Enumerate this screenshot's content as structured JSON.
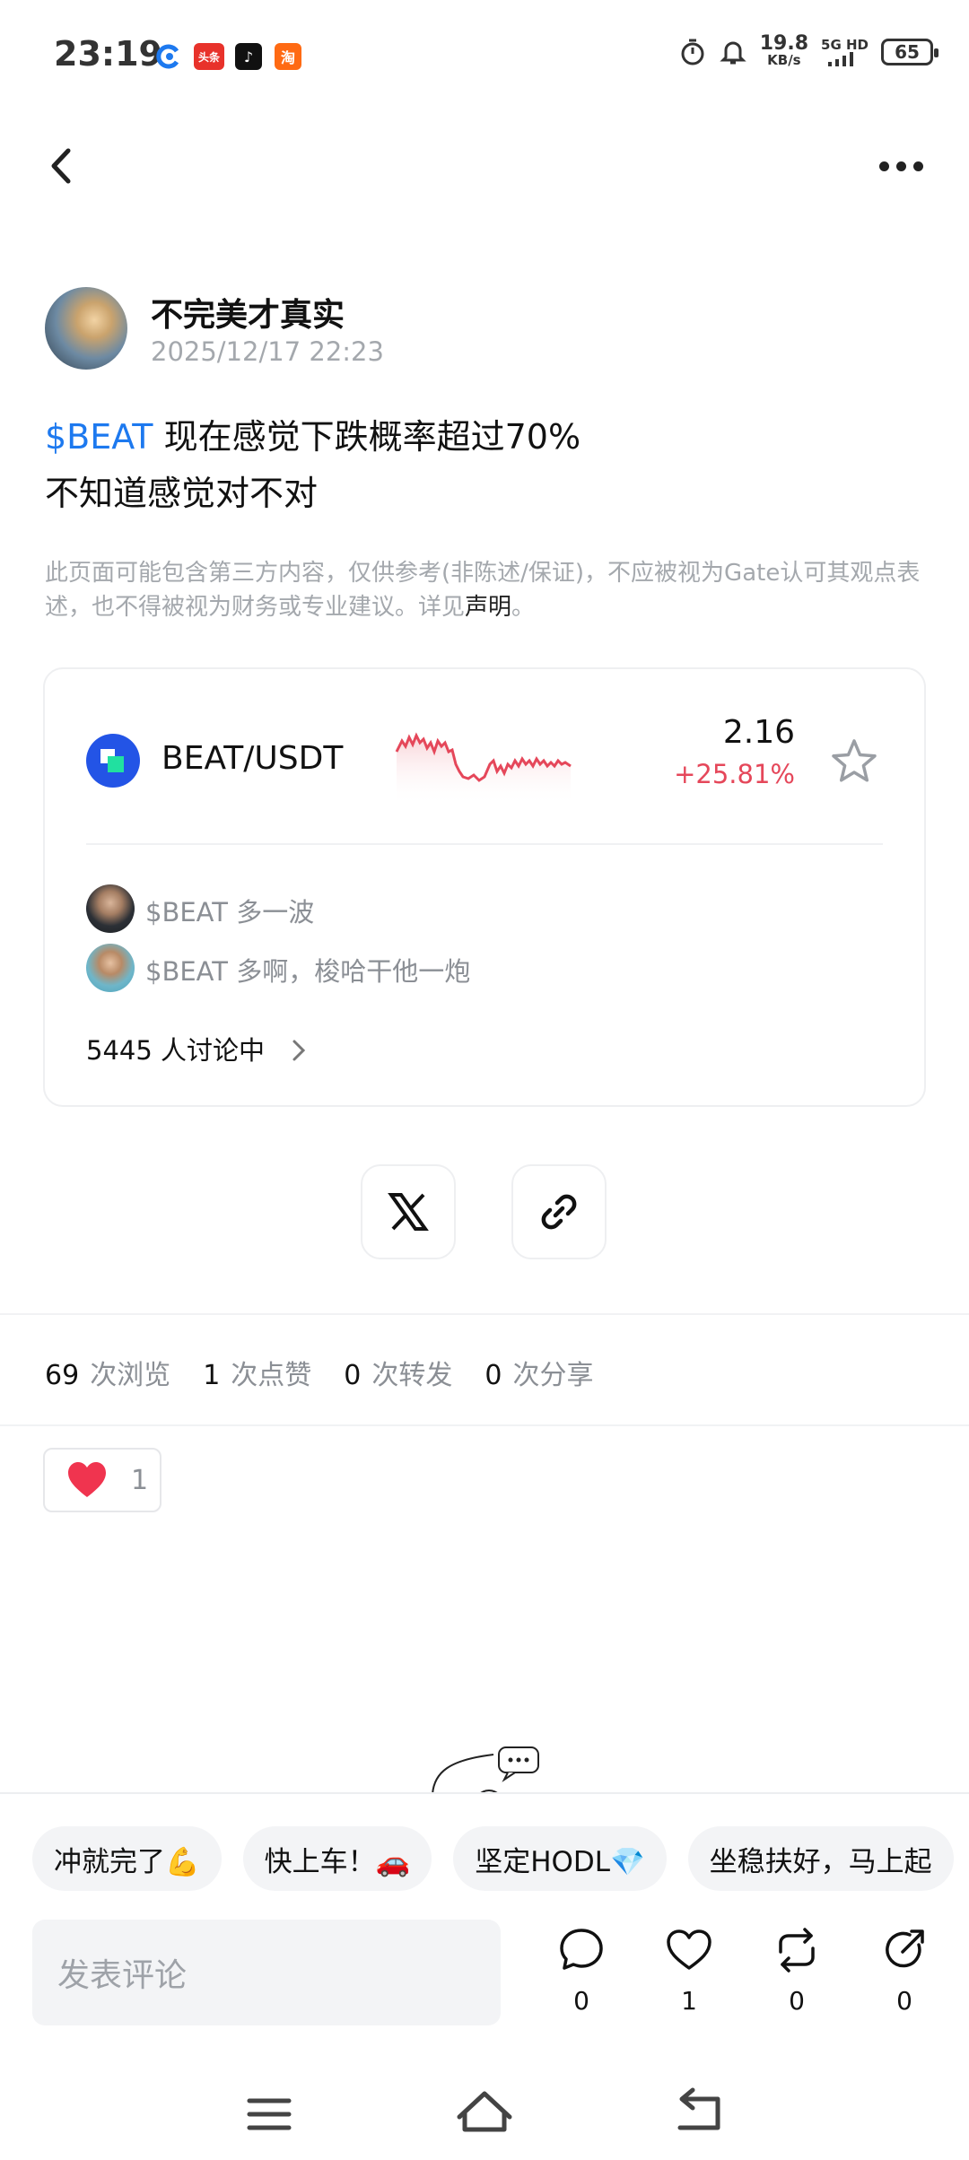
{
  "status_bar": {
    "time": "23:19",
    "net_speed": "19.8",
    "net_unit": "KB/s",
    "signal": "5G HD",
    "battery": "65",
    "apps": [
      "G",
      "头条",
      "♪",
      "淘"
    ]
  },
  "post": {
    "author": "不完美才真实",
    "time": "2025/12/17 22:23",
    "tag": "$BEAT",
    "line1": " 现在感觉下跌概率超过70%",
    "line2": "不知道感觉对不对",
    "disclaimer": "此页面可能包含第三方内容，仅供参考(非陈述/保证)，不应被视为Gate认可其观点表述，也不得被视为财务或专业建议。详见",
    "disclaimer_link": "声明",
    "disclaimer_end": "。"
  },
  "market_card": {
    "pair": "BEAT/USDT",
    "price": "2.16",
    "change": "+25.81%",
    "comments": [
      {
        "text": "$BEAT 多一波"
      },
      {
        "text": "$BEAT 多啊，梭哈干他一炮"
      }
    ],
    "discussing": "5445 人讨论中"
  },
  "stats": [
    {
      "value": "69",
      "label": "次浏览"
    },
    {
      "value": "1",
      "label": "次点赞"
    },
    {
      "value": "0",
      "label": "次转发"
    },
    {
      "value": "0",
      "label": "次分享"
    }
  ],
  "reaction": {
    "emoji": "heart",
    "count": "1"
  },
  "quick_replies": [
    "冲就完了💪",
    "快上车！🚗",
    "坚定HODL💎",
    "坐稳扶好，马上起"
  ],
  "comment_box": {
    "placeholder": "发表评论"
  },
  "actions": {
    "comment": "0",
    "like": "1",
    "repost": "0",
    "share": "0"
  },
  "colors": {
    "accent": "#1d79ef",
    "up": "#e5475a",
    "heart": "#f0344f"
  }
}
